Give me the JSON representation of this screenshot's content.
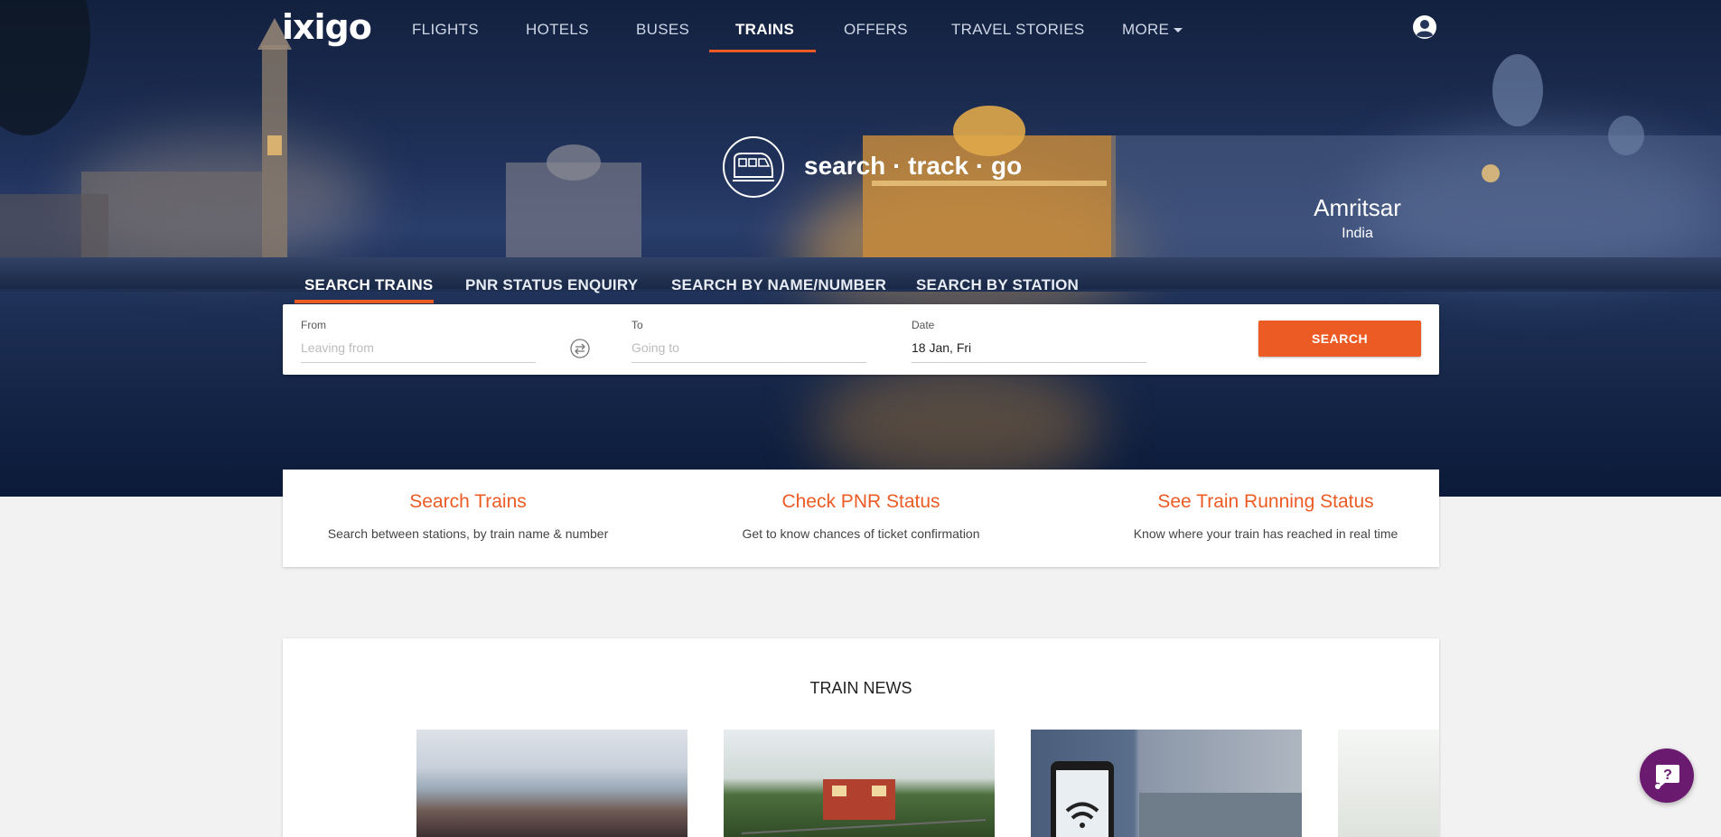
{
  "brand": {
    "logo_text": "ixigo",
    "accent": "#ec5b24"
  },
  "nav": {
    "items": [
      {
        "label": "FLIGHTS"
      },
      {
        "label": "HOTELS"
      },
      {
        "label": "BUSES"
      },
      {
        "label": "TRAINS",
        "active": true
      },
      {
        "label": "OFFERS"
      },
      {
        "label": "TRAVEL STORIES"
      },
      {
        "label": "MORE"
      }
    ],
    "user_icon": "user-circle-icon"
  },
  "hero": {
    "tagline": "search · track · go",
    "tagline_icon": "train-icon",
    "city": "Amritsar",
    "country": "India"
  },
  "search_tabs": [
    {
      "label": "SEARCH TRAINS",
      "active": true
    },
    {
      "label": "PNR STATUS ENQUIRY"
    },
    {
      "label": "SEARCH BY NAME/NUMBER"
    },
    {
      "label": "SEARCH BY STATION"
    }
  ],
  "search_form": {
    "from": {
      "label": "From",
      "placeholder": "Leaving from",
      "value": ""
    },
    "to": {
      "label": "To",
      "placeholder": "Going to",
      "value": ""
    },
    "date": {
      "label": "Date",
      "value": "18 Jan, Fri"
    },
    "swap_icon": "swap-icon",
    "button": "SEARCH"
  },
  "features": [
    {
      "title": "Search Trains",
      "desc": "Search between stations, by train name & number"
    },
    {
      "title": "Check PNR Status",
      "desc": "Get to know chances of ticket confirmation"
    },
    {
      "title": "See Train Running Status",
      "desc": "Know where your train has reached in real time"
    }
  ],
  "news": {
    "title": "TRAIN NEWS"
  },
  "chat": {
    "icon": "chat-help-icon"
  }
}
